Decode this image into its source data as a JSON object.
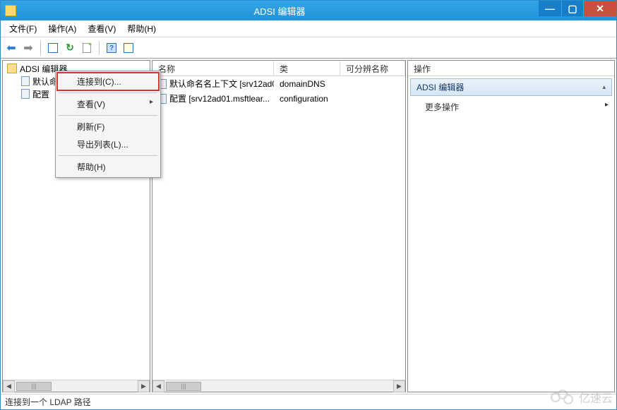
{
  "window": {
    "title": "ADSI 编辑器"
  },
  "menubar": {
    "file": "文件(F)",
    "action": "操作(A)",
    "view": "查看(V)",
    "help": "帮助(H)"
  },
  "tree": {
    "root": "ADSI 编辑器",
    "items": [
      {
        "label": "默认命名名上下文"
      },
      {
        "label": "配置"
      }
    ]
  },
  "list": {
    "columns": {
      "name": "名称",
      "class": "类",
      "dn": "可分辨名称"
    },
    "rows": [
      {
        "name": "默认命名名上下文 [srv12ad0...",
        "class": "domainDNS",
        "dn": ""
      },
      {
        "name": "配置 [srv12ad01.msftlear...",
        "class": "configuration",
        "dn": ""
      }
    ]
  },
  "actions": {
    "title": "操作",
    "section": "ADSI 编辑器",
    "more": "更多操作"
  },
  "context_menu": {
    "connect": "连接到(C)...",
    "view": "查看(V)",
    "refresh": "刷新(F)",
    "export": "导出列表(L)...",
    "help": "帮助(H)"
  },
  "statusbar": {
    "text": "连接到一个 LDAP 路径"
  },
  "watermark": "亿速云",
  "scroll_thumb": "|||"
}
